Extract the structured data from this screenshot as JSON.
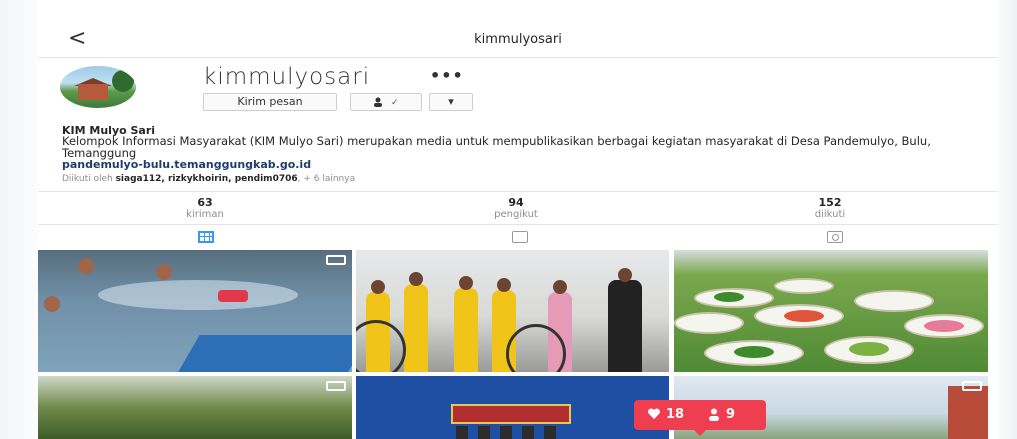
{
  "topbar": {
    "back": "<",
    "title": "kimmulyosari"
  },
  "profile": {
    "username": "kimmulyosari",
    "more": "•••",
    "message_button": "Kirim pesan",
    "follow_button": "✓",
    "dropdown_button": "▾"
  },
  "bio": {
    "name": "KIM Mulyo Sari",
    "text": "Kelompok Informasi Masyarakat (KIM Mulyo Sari) merupakan media untuk mempublikasikan berbagai kegiatan masyarakat di Desa Pandemulyo, Bulu, Temanggung",
    "link": "pandemulyo-bulu.temanggungkab.go.id",
    "followed_by_prefix": "Diikuti oleh ",
    "followed_by_names": "siaga112, rizkykhoirin, pendim0706",
    "followed_by_suffix": ", + 6 lainnya"
  },
  "stats": [
    {
      "value": "63",
      "label": "kiriman"
    },
    {
      "value": "94",
      "label": "pengikut"
    },
    {
      "value": "152",
      "label": "diikuti"
    }
  ],
  "notification": {
    "likes": "18",
    "followers": "9"
  },
  "colors": {
    "accent": "#3897f0",
    "notify": "#ee3e4f",
    "link": "#1e3d6e"
  },
  "icons": [
    "back-arrow-icon",
    "more-icon",
    "follow-check-icon",
    "chevron-down-icon",
    "grid-icon",
    "feed-icon",
    "tagged-icon",
    "video-icon",
    "heart-icon",
    "person-icon"
  ]
}
